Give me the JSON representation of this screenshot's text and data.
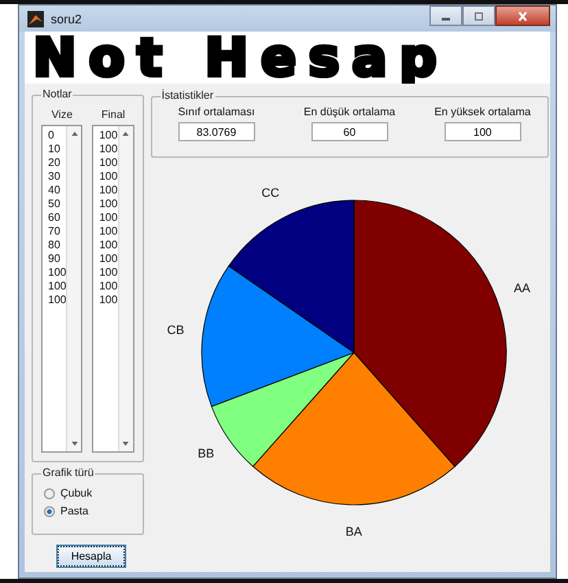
{
  "window": {
    "title": "soru2",
    "banner": "Not Hesap"
  },
  "grades": {
    "title": "Notlar",
    "columns": [
      {
        "heading": "Vize",
        "values": [
          "0",
          "10",
          "20",
          "30",
          "40",
          "50",
          "60",
          "70",
          "80",
          "90",
          "100",
          "100",
          "100"
        ]
      },
      {
        "heading": "Final",
        "values": [
          "100",
          "100",
          "100",
          "100",
          "100",
          "100",
          "100",
          "100",
          "100",
          "100",
          "100",
          "100",
          "100"
        ]
      }
    ]
  },
  "statistics": {
    "title": "İstatistikler",
    "fields": [
      {
        "label": "Sınıf ortalaması",
        "value": "83.0769"
      },
      {
        "label": "En düşük ortalama",
        "value": "60"
      },
      {
        "label": "En yüksek ortalama",
        "value": "100"
      }
    ]
  },
  "chart_type": {
    "title": "Grafik türü",
    "options": [
      {
        "label": "Çubuk",
        "selected": false
      },
      {
        "label": "Pasta",
        "selected": true
      }
    ]
  },
  "buttons": [
    "Hesapla"
  ],
  "chart": {
    "chart_data": {
      "type": "pie",
      "categories": [
        "AA",
        "BA",
        "BB",
        "CB",
        "CC"
      ],
      "values": [
        38.47,
        23.08,
        7.69,
        15.38,
        15.38
      ]
    }
  }
}
